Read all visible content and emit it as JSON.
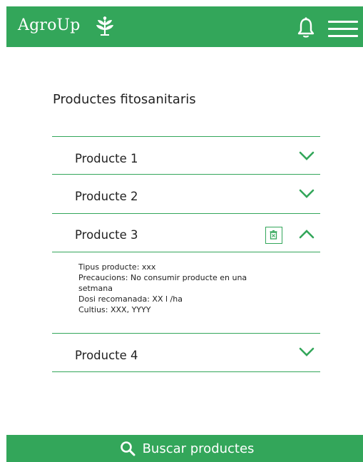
{
  "header": {
    "logo_text": "AgroUp",
    "logo_icon": "leaf-icon",
    "notification_icon": "bell-icon",
    "menu_icon": "hamburger-menu-icon"
  },
  "page": {
    "title": "Productes fitosanitaris"
  },
  "products": [
    {
      "label": "Producte 1",
      "expanded": false
    },
    {
      "label": "Producte 2",
      "expanded": false
    },
    {
      "label": "Producte 3",
      "expanded": true
    },
    {
      "label": "Producte 4",
      "expanded": false
    }
  ],
  "expanded_details": {
    "lines": [
      "Tipus producte: xxx",
      "Precaucions: No consumir producte en una",
      "setmana",
      "Dosi recomanada: XX l /ha",
      "Cultius: XXX, YYYY"
    ]
  },
  "footer": {
    "search_label": "Buscar productes",
    "search_icon": "search-icon"
  },
  "colors": {
    "accent": "#33a65a",
    "background": "#ffffff",
    "text": "#222222"
  }
}
